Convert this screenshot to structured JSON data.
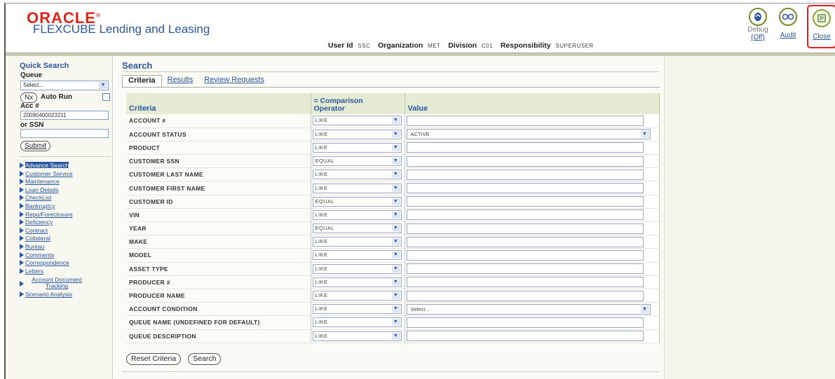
{
  "header": {
    "oracle_brand": "ORACLE",
    "product_name": "FLEXCUBE Lending and Leasing",
    "user_id_label": "User Id",
    "user_id_value": "SSC",
    "organization_label": "Organization",
    "organization_value": "MET",
    "division_label": "Division",
    "division_value": "C01",
    "responsibility_label": "Responsibility",
    "responsibility_value": "SUPERUSER",
    "tools": {
      "debug_label": "Debug",
      "debug_state": "(Off)",
      "audit_label": "Audit",
      "close_label": "Close"
    }
  },
  "quick_search": {
    "title": "Quick Search",
    "queue_label": "Queue",
    "queue_value": "Select...",
    "next_button": "Nx",
    "auto_run_label": "Auto Run",
    "acc_label": "Acc #",
    "acc_value": "20090400023211",
    "ssn_label": "or SSN",
    "ssn_value": "",
    "submit_button": "Submit"
  },
  "nav": {
    "items": [
      {
        "label": "Advance Search",
        "selected": true
      },
      {
        "label": "Customer Service"
      },
      {
        "label": "Maintenance"
      },
      {
        "label": "Loan Details"
      },
      {
        "label": "CheckList"
      },
      {
        "label": "Bankruptcy"
      },
      {
        "label": "Repo/Foreclosure"
      },
      {
        "label": "Deficiency"
      },
      {
        "label": "Contract"
      },
      {
        "label": "Collateral"
      },
      {
        "label": "Bureau"
      },
      {
        "label": "Comments"
      },
      {
        "label": "Correspondence"
      },
      {
        "label": "Letters"
      },
      {
        "label": "Account Document Tracking"
      },
      {
        "label": "Scenario Analysis"
      }
    ]
  },
  "search": {
    "title": "Search",
    "tabs": [
      "Criteria",
      "Results",
      "Review Requests"
    ],
    "columns": {
      "criteria": "Criteria",
      "operator_line1": "= Comparison",
      "operator_line2": "Operator",
      "value": "Value"
    },
    "rows": [
      {
        "criteria": "ACCOUNT #",
        "operator": "LIKE",
        "value": ""
      },
      {
        "criteria": "ACCOUNT STATUS",
        "operator": "LIKE",
        "value": "ACTIVE"
      },
      {
        "criteria": "PRODUCT",
        "operator": "LIKE",
        "value": ""
      },
      {
        "criteria": "CUSTOMER SSN",
        "operator": "EQUAL",
        "value": ""
      },
      {
        "criteria": "CUSTOMER LAST NAME",
        "operator": "LIKE",
        "value": ""
      },
      {
        "criteria": "CUSTOMER FIRST NAME",
        "operator": "LIKE",
        "value": ""
      },
      {
        "criteria": "CUSTOMER ID",
        "operator": "EQUAL",
        "value": ""
      },
      {
        "criteria": "VIN",
        "operator": "LIKE",
        "value": ""
      },
      {
        "criteria": "YEAR",
        "operator": "EQUAL",
        "value": ""
      },
      {
        "criteria": "MAKE",
        "operator": "LIKE",
        "value": ""
      },
      {
        "criteria": "MODEL",
        "operator": "LIKE",
        "value": ""
      },
      {
        "criteria": "ASSET TYPE",
        "operator": "LIKE",
        "value": ""
      },
      {
        "criteria": "PRODUCER #",
        "operator": "LIKE",
        "value": ""
      },
      {
        "criteria": "PRODUCER NAME",
        "operator": "LIKE",
        "value": ""
      },
      {
        "criteria": "ACCOUNT CONDITION",
        "operator": "LIKE",
        "value": "Select..."
      },
      {
        "criteria": "QUEUE NAME (UNDEFINED FOR DEFAULT)",
        "operator": "LIKE",
        "value": ""
      },
      {
        "criteria": "QUEUE DESCRIPTION",
        "operator": "LIKE",
        "value": ""
      }
    ],
    "dropdown_value_rows": [
      1,
      14
    ],
    "reset_button": "Reset Criteria",
    "search_button": "Search"
  }
}
